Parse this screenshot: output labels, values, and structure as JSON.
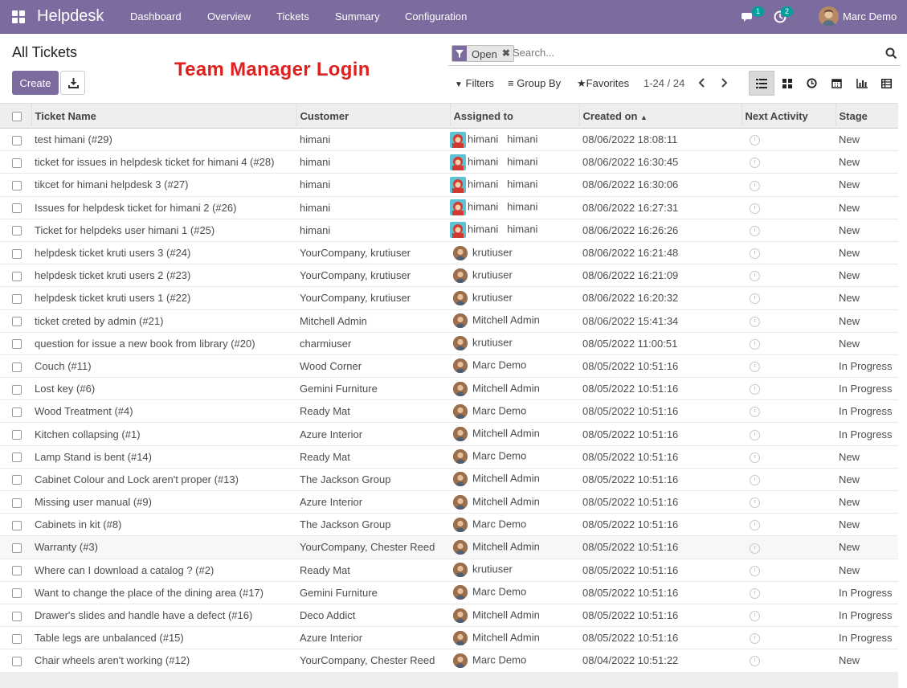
{
  "navbar": {
    "brand": "Helpdesk",
    "menu": [
      "Dashboard",
      "Overview",
      "Tickets",
      "Summary",
      "Configuration"
    ],
    "messages_count": "1",
    "activities_count": "2",
    "user": "Marc Demo"
  },
  "page": {
    "title": "All Tickets",
    "overlay_text": "Team Manager Login",
    "create_label": "Create"
  },
  "search": {
    "facet": "Open",
    "placeholder": "Search...",
    "filters_label": "Filters",
    "groupby_label": "Group By",
    "favorites_label": "Favorites"
  },
  "pager": {
    "range": "1-24 / 24"
  },
  "table": {
    "columns": [
      "Ticket Name",
      "Customer",
      "Assigned to",
      "Created on",
      "Next Activity",
      "Stage"
    ],
    "rows": [
      {
        "name": "test himani (#29)",
        "customer": "himani",
        "assignee": "himani",
        "assignee2": "himani",
        "created": "08/06/2022 18:08:11",
        "stage": "New"
      },
      {
        "name": "ticket for issues in helpdesk ticket for himani 4 (#28)",
        "customer": "himani",
        "assignee": "himani",
        "assignee2": "himani",
        "created": "08/06/2022 16:30:45",
        "stage": "New"
      },
      {
        "name": "tikcet for himani helpdesk 3 (#27)",
        "customer": "himani",
        "assignee": "himani",
        "assignee2": "himani",
        "created": "08/06/2022 16:30:06",
        "stage": "New"
      },
      {
        "name": "Issues for helpdesk ticket for himani 2 (#26)",
        "customer": "himani",
        "assignee": "himani",
        "assignee2": "himani",
        "created": "08/06/2022 16:27:31",
        "stage": "New"
      },
      {
        "name": "Ticket for helpdeks user himani 1 (#25)",
        "customer": "himani",
        "assignee": "himani",
        "assignee2": "himani",
        "created": "08/06/2022 16:26:26",
        "stage": "New"
      },
      {
        "name": "helpdesk ticket kruti users 3 (#24)",
        "customer": "YourCompany, krutiuser",
        "assignee": "krutiuser",
        "created": "08/06/2022 16:21:48",
        "stage": "New"
      },
      {
        "name": "helpdesk ticket kruti users 2 (#23)",
        "customer": "YourCompany, krutiuser",
        "assignee": "krutiuser",
        "created": "08/06/2022 16:21:09",
        "stage": "New"
      },
      {
        "name": "helpdesk ticket kruti users 1 (#22)",
        "customer": "YourCompany, krutiuser",
        "assignee": "krutiuser",
        "created": "08/06/2022 16:20:32",
        "stage": "New"
      },
      {
        "name": "ticket creted by admin (#21)",
        "customer": "Mitchell Admin",
        "assignee": "Mitchell Admin",
        "created": "08/06/2022 15:41:34",
        "stage": "New"
      },
      {
        "name": "question for issue a new book from library (#20)",
        "customer": "charmiuser",
        "assignee": "krutiuser",
        "created": "08/05/2022 11:00:51",
        "stage": "New"
      },
      {
        "name": "Couch (#11)",
        "customer": "Wood Corner",
        "assignee": "Marc Demo",
        "created": "08/05/2022 10:51:16",
        "stage": "In Progress"
      },
      {
        "name": "Lost key (#6)",
        "customer": "Gemini Furniture",
        "assignee": "Mitchell Admin",
        "created": "08/05/2022 10:51:16",
        "stage": "In Progress"
      },
      {
        "name": "Wood Treatment (#4)",
        "customer": "Ready Mat",
        "assignee": "Marc Demo",
        "created": "08/05/2022 10:51:16",
        "stage": "In Progress"
      },
      {
        "name": "Kitchen collapsing (#1)",
        "customer": "Azure Interior",
        "assignee": "Mitchell Admin",
        "created": "08/05/2022 10:51:16",
        "stage": "In Progress"
      },
      {
        "name": "Lamp Stand is bent (#14)",
        "customer": "Ready Mat",
        "assignee": "Marc Demo",
        "created": "08/05/2022 10:51:16",
        "stage": "New"
      },
      {
        "name": "Cabinet Colour and Lock aren't proper (#13)",
        "customer": "The Jackson Group",
        "assignee": "Mitchell Admin",
        "created": "08/05/2022 10:51:16",
        "stage": "New"
      },
      {
        "name": "Missing user manual (#9)",
        "customer": "Azure Interior",
        "assignee": "Mitchell Admin",
        "created": "08/05/2022 10:51:16",
        "stage": "New"
      },
      {
        "name": "Cabinets in kit (#8)",
        "customer": "The Jackson Group",
        "assignee": "Marc Demo",
        "created": "08/05/2022 10:51:16",
        "stage": "New"
      },
      {
        "name": "Warranty (#3)",
        "customer": "YourCompany, Chester Reed",
        "assignee": "Mitchell Admin",
        "created": "08/05/2022 10:51:16",
        "stage": "New"
      },
      {
        "name": "Where can I download a catalog ? (#2)",
        "customer": "Ready Mat",
        "assignee": "krutiuser",
        "created": "08/05/2022 10:51:16",
        "stage": "New"
      },
      {
        "name": "Want to change the place of the dining area (#17)",
        "customer": "Gemini Furniture",
        "assignee": "Marc Demo",
        "created": "08/05/2022 10:51:16",
        "stage": "In Progress"
      },
      {
        "name": "Drawer's slides and handle have a defect (#16)",
        "customer": "Deco Addict",
        "assignee": "Mitchell Admin",
        "created": "08/05/2022 10:51:16",
        "stage": "In Progress"
      },
      {
        "name": "Table legs are unbalanced (#15)",
        "customer": "Azure Interior",
        "assignee": "Mitchell Admin",
        "created": "08/05/2022 10:51:16",
        "stage": "In Progress"
      },
      {
        "name": "Chair wheels aren't working (#12)",
        "customer": "YourCompany, Chester Reed",
        "assignee": "Marc Demo",
        "created": "08/04/2022 10:51:22",
        "stage": "New"
      }
    ]
  }
}
